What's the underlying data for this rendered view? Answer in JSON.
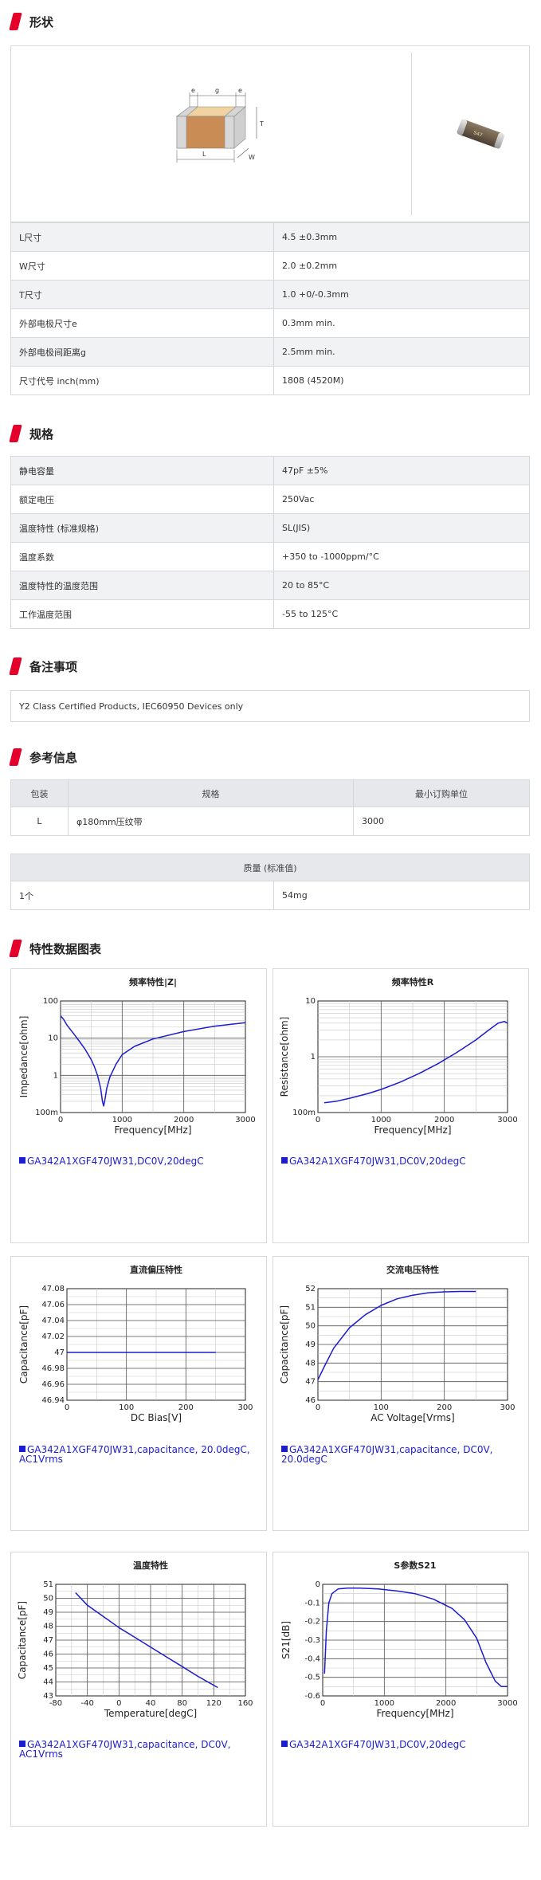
{
  "sections": {
    "shape": "形状",
    "spec": "规格",
    "notes": "备注事项",
    "reference": "参考信息",
    "charts": "特性数据图表"
  },
  "diagram_labels": {
    "e": "e",
    "g": "g",
    "T": "T",
    "W": "W",
    "L": "L"
  },
  "chip_marking": "S47",
  "dimensions": [
    {
      "label": "L尺寸",
      "value": "4.5 ±0.3mm"
    },
    {
      "label": "W尺寸",
      "value": "2.0 ±0.2mm"
    },
    {
      "label": "T尺寸",
      "value": "1.0 +0/-0.3mm"
    },
    {
      "label": "外部电极尺寸e",
      "value": "0.3mm min."
    },
    {
      "label": "外部电极间距离g",
      "value": "2.5mm min."
    },
    {
      "label": "尺寸代号 inch(mm)",
      "value": "1808 (4520M)"
    }
  ],
  "specs": [
    {
      "label": "静电容量",
      "value": "47pF ±5%"
    },
    {
      "label": "额定电压",
      "value": "250Vac"
    },
    {
      "label": "温度特性 (标准规格)",
      "value": "SL(JIS)"
    },
    {
      "label": "温度系数",
      "value": "+350 to -1000ppm/°C"
    },
    {
      "label": "温度特性的温度范围",
      "value": "20 to 85°C"
    },
    {
      "label": "工作温度范围",
      "value": "-55 to 125°C"
    }
  ],
  "notes_text": "Y2 Class Certified Products, IEC60950 Devices only",
  "packaging": {
    "headers": [
      "包装",
      "规格",
      "最小订购单位"
    ],
    "row": [
      "L",
      "φ180mm压纹带",
      "3000"
    ]
  },
  "mass": {
    "header": "质量 (标准值)",
    "row": [
      "1个",
      "54mg"
    ]
  },
  "chart_data": [
    {
      "type": "line",
      "title": "频率特性|Z|",
      "xlabel": "Frequency[MHz]",
      "ylabel": "Impedance[ohm]",
      "xlim": [
        0,
        3000
      ],
      "ylim": [
        0.1,
        100
      ],
      "yscale": "log",
      "xticks": [
        "0",
        "1000",
        "2000",
        "3000"
      ],
      "yticks": [
        "100m",
        "1",
        "10",
        "100"
      ],
      "x": [
        0,
        50,
        100,
        200,
        300,
        400,
        500,
        550,
        600,
        650,
        680,
        700,
        720,
        750,
        800,
        900,
        1000,
        1200,
        1500,
        2000,
        2500,
        3000
      ],
      "y": [
        40,
        32,
        23,
        14,
        8.5,
        5,
        2.6,
        1.7,
        1.0,
        0.45,
        0.2,
        0.15,
        0.22,
        0.45,
        0.9,
        2.0,
        3.6,
        6.0,
        9.5,
        15,
        21,
        26
      ],
      "legend": "GA342A1XGF470JW31,DC0V,20degC"
    },
    {
      "type": "line",
      "title": "频率特性R",
      "xlabel": "Frequency[MHz]",
      "ylabel": "Resistance[ohm]",
      "xlim": [
        0,
        3000
      ],
      "ylim": [
        0.1,
        10
      ],
      "yscale": "log",
      "xticks": [
        "0",
        "1000",
        "2000",
        "3000"
      ],
      "yticks": [
        "100m",
        "1",
        "10"
      ],
      "x": [
        100,
        300,
        500,
        800,
        1000,
        1300,
        1600,
        1900,
        2200,
        2500,
        2700,
        2850,
        2950,
        3000
      ],
      "y": [
        0.15,
        0.16,
        0.18,
        0.22,
        0.26,
        0.35,
        0.5,
        0.75,
        1.2,
        2.0,
        3.0,
        4.0,
        4.3,
        4.0
      ],
      "legend": "GA342A1XGF470JW31,DC0V,20degC"
    },
    {
      "type": "line",
      "title": "直流偏压特性",
      "xlabel": "DC Bias[V]",
      "ylabel": "Capacitance[pF]",
      "xlim": [
        0,
        300
      ],
      "ylim": [
        46.94,
        47.08
      ],
      "xticks": [
        "0",
        "100",
        "200",
        "300"
      ],
      "yticks": [
        "46.94",
        "46.96",
        "46.98",
        "47",
        "47.02",
        "47.04",
        "47.06",
        "47.08"
      ],
      "x": [
        0,
        250
      ],
      "y": [
        47,
        47
      ],
      "legend": "GA342A1XGF470JW31,capacitance, 20.0degC, AC1Vrms"
    },
    {
      "type": "line",
      "title": "交流电压特性",
      "xlabel": "AC Voltage[Vrms]",
      "ylabel": "Capacitance[pF]",
      "xlim": [
        0,
        300
      ],
      "ylim": [
        46,
        52
      ],
      "xticks": [
        "0",
        "100",
        "200",
        "300"
      ],
      "yticks": [
        "46",
        "47",
        "48",
        "49",
        "50",
        "51",
        "52"
      ],
      "x": [
        0,
        10,
        25,
        50,
        75,
        100,
        125,
        150,
        175,
        200,
        225,
        250
      ],
      "y": [
        47.1,
        47.8,
        48.8,
        49.9,
        50.6,
        51.1,
        51.45,
        51.65,
        51.78,
        51.83,
        51.85,
        51.85
      ],
      "legend": "GA342A1XGF470JW31,capacitance, DC0V, 20.0degC"
    },
    {
      "type": "line",
      "title": "温度特性",
      "xlabel": "Temperature[degC]",
      "ylabel": "Capacitance[pF]",
      "xlim": [
        -80,
        160
      ],
      "ylim": [
        43,
        51
      ],
      "xticks": [
        "-80",
        "-40",
        "0",
        "40",
        "80",
        "120",
        "160"
      ],
      "yticks": [
        "43",
        "44",
        "45",
        "46",
        "47",
        "48",
        "49",
        "50",
        "51"
      ],
      "x": [
        -55,
        -40,
        -20,
        0,
        20,
        40,
        60,
        80,
        100,
        125
      ],
      "y": [
        50.4,
        49.5,
        48.7,
        47.9,
        47.2,
        46.5,
        45.8,
        45.1,
        44.4,
        43.6
      ],
      "legend": "GA342A1XGF470JW31,capacitance, DC0V, AC1Vrms"
    },
    {
      "type": "line",
      "title": "S参数S21",
      "xlabel": "Frequency[MHz]",
      "ylabel": "S21[dB]",
      "xlim": [
        0,
        3000
      ],
      "ylim": [
        -0.6,
        0
      ],
      "xticks": [
        "0",
        "1000",
        "2000",
        "3000"
      ],
      "yticks": [
        "-0.6",
        "-0.5",
        "-0.4",
        "-0.3",
        "-0.2",
        "-0.1",
        "0"
      ],
      "x": [
        30,
        60,
        100,
        150,
        250,
        400,
        600,
        900,
        1200,
        1500,
        1800,
        2100,
        2300,
        2500,
        2650,
        2800,
        2900,
        3000
      ],
      "y": [
        -0.48,
        -0.25,
        -0.1,
        -0.05,
        -0.025,
        -0.02,
        -0.02,
        -0.025,
        -0.035,
        -0.05,
        -0.08,
        -0.13,
        -0.19,
        -0.29,
        -0.42,
        -0.52,
        -0.55,
        -0.55
      ],
      "legend": "GA342A1XGF470JW31,DC0V,20degC"
    }
  ]
}
